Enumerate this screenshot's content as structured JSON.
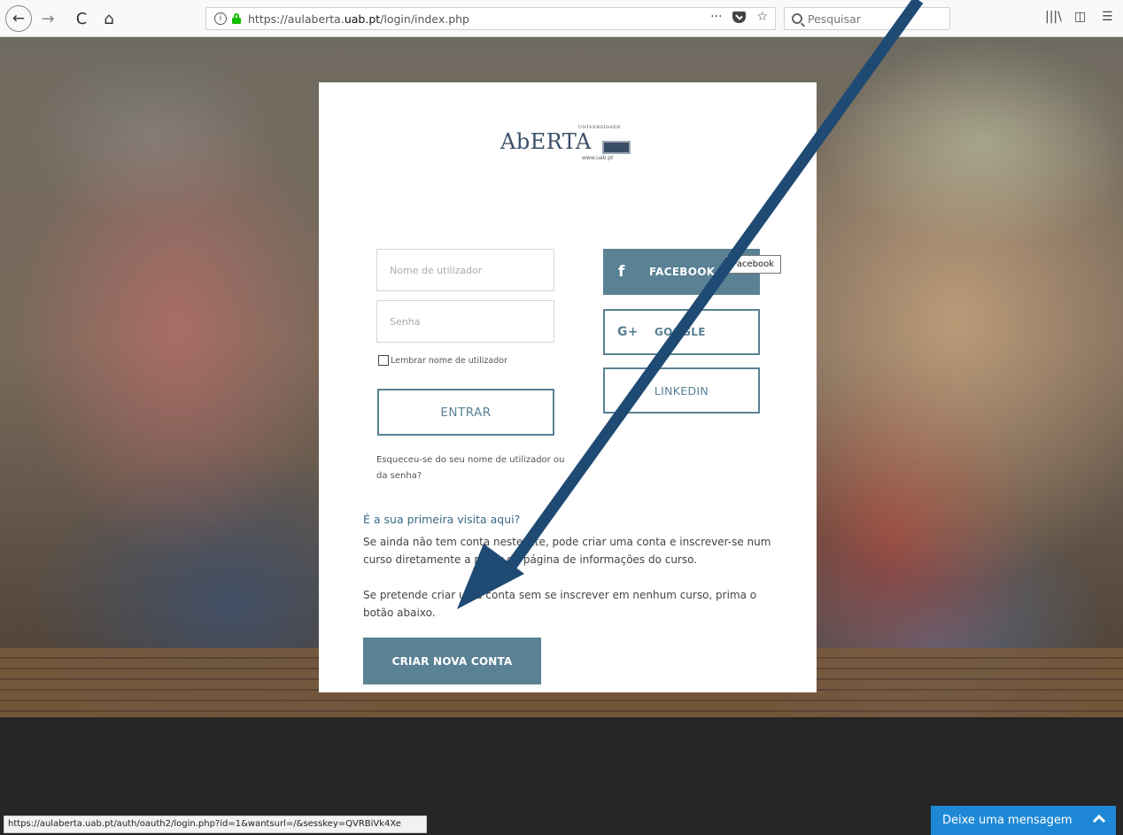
{
  "browser": {
    "url_prefix": "https://aulaberta.",
    "url_domain": "uab.pt",
    "url_path": "/login/index.php",
    "search_placeholder": "Pesquisar",
    "info_icon": "i",
    "more_icon": "···",
    "bookmark_icon": "☆",
    "library_icon": "|||\\",
    "sidebar_icon": "◫",
    "menu_icon": "☰",
    "back_icon": "←",
    "forward_icon": "→",
    "reload_icon": "C",
    "home_icon": "⌂"
  },
  "logo": {
    "univ": "UNIVERSIDADE",
    "brand": "AbERTA",
    "site": "www.uab.pt"
  },
  "login": {
    "username_placeholder": "Nome de utilizador",
    "password_placeholder": "Senha",
    "remember_label": "Lembrar nome de utilizador",
    "submit_label": "ENTRAR",
    "forgot_label": "Esqueceu-se do seu nome de utilizador ou da senha?"
  },
  "social": {
    "facebook_icon": "f",
    "facebook_label": "FACEBOOK",
    "google_icon": "G+",
    "google_label": "GOOGLE",
    "linkedin_label": "LINKEDIN",
    "tooltip": "Facebook"
  },
  "signup": {
    "heading": "É a sua primeira visita aqui?",
    "text1": "Se ainda não tem conta neste site, pode criar uma conta e inscrever-se num curso diretamente a partir da página de informações do curso.",
    "text2": "Se pretende criar uma conta sem se inscrever em nenhum curso, prima o botão abaixo.",
    "button": "CRIAR NOVA CONTA"
  },
  "status_url": "https://aulaberta.uab.pt/auth/oauth2/login.php?id=1&wantsurl=/&sesskey=QVRBiVk4Xe",
  "chat": {
    "label": "Deixe uma mensagem"
  },
  "colors": {
    "accent": "#5a8194",
    "arrow": "#1f4a73",
    "chat": "#1e88d6"
  }
}
